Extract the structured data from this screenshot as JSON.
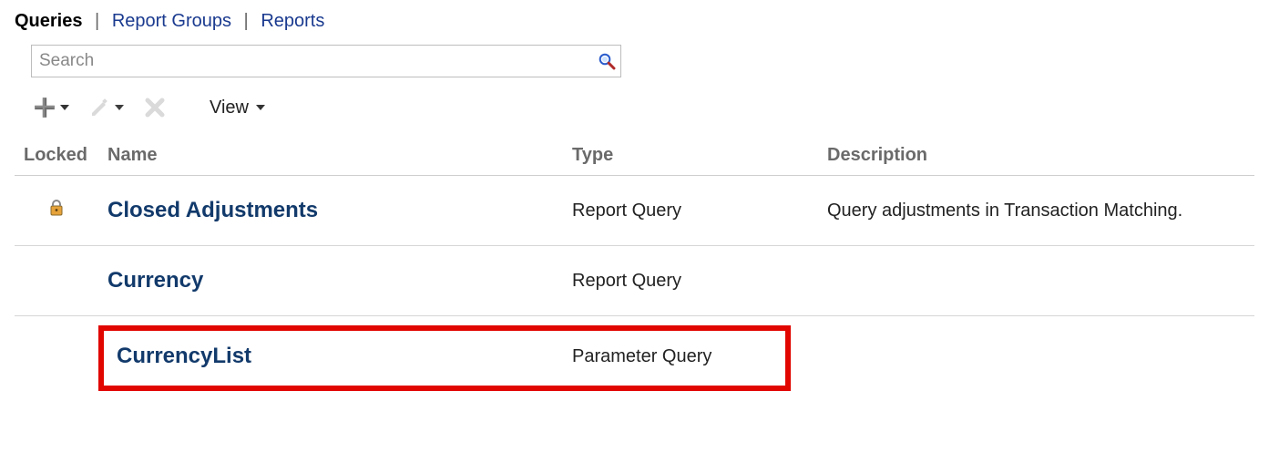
{
  "tabs": {
    "queries": "Queries",
    "report_groups": "Report Groups",
    "reports": "Reports"
  },
  "search": {
    "placeholder": "Search"
  },
  "toolbar": {
    "view_label": "View",
    "add_icon": "plus-icon",
    "edit_icon": "pencil-icon",
    "delete_icon": "x-icon"
  },
  "columns": {
    "locked": "Locked",
    "name": "Name",
    "type": "Type",
    "description": "Description"
  },
  "rows": [
    {
      "locked": true,
      "name": "Closed Adjustments",
      "type": "Report Query",
      "description": "Query adjustments in Transaction Matching."
    },
    {
      "locked": false,
      "name": "Currency",
      "type": "Report Query",
      "description": ""
    },
    {
      "locked": false,
      "name": "CurrencyList",
      "type": "Parameter Query",
      "description": ""
    }
  ]
}
